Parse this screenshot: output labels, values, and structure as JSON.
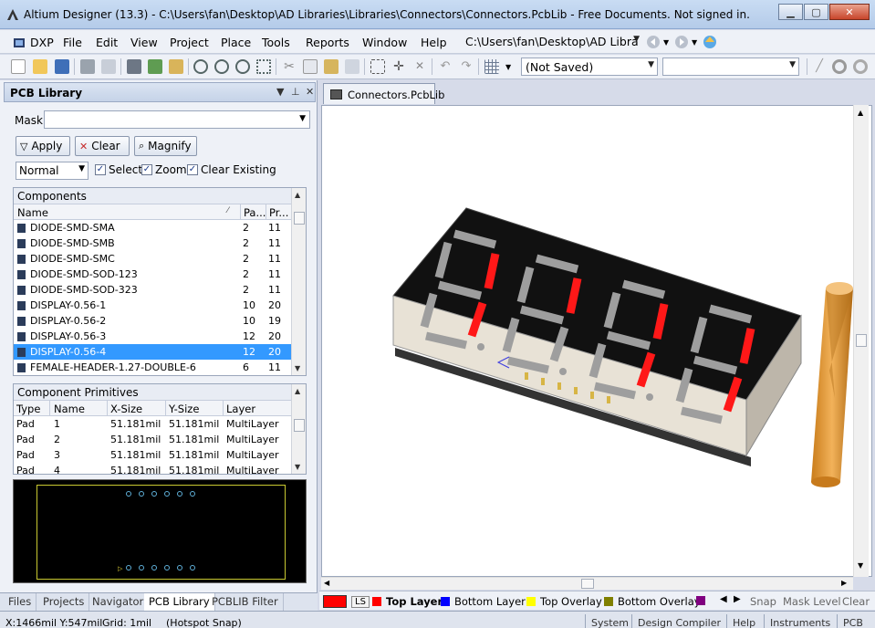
{
  "window": {
    "title": "Altium Designer (13.3) - C:\\Users\\fan\\Desktop\\AD Libraries\\Libraries\\Connectors\\Connectors.PcbLib - Free Documents. Not signed in."
  },
  "menu": {
    "items": [
      "DXP",
      "File",
      "Edit",
      "View",
      "Project",
      "Place",
      "Tools",
      "Reports",
      "Window",
      "Help"
    ],
    "path_combo": "C:\\Users\\fan\\Desktop\\AD Libra"
  },
  "toolbar": {
    "saved_state": "(Not Saved)"
  },
  "panel": {
    "title": "PCB Library",
    "mask_label": "Mask",
    "mask_value": "",
    "buttons": {
      "apply": "Apply",
      "clear": "Clear",
      "magnify": "Magnify"
    },
    "mode": "Normal",
    "checks": [
      {
        "label": "Select",
        "checked": true
      },
      {
        "label": "Zoom",
        "checked": true
      },
      {
        "label": "Clear Existing",
        "checked": true
      }
    ],
    "components": {
      "title": "Components",
      "headers": [
        "Name",
        "Pa...",
        "Pr..."
      ],
      "rows": [
        {
          "name": "DIODE-SMD-SMA",
          "pads": "2",
          "prims": "11"
        },
        {
          "name": "DIODE-SMD-SMB",
          "pads": "2",
          "prims": "11"
        },
        {
          "name": "DIODE-SMD-SMC",
          "pads": "2",
          "prims": "11"
        },
        {
          "name": "DIODE-SMD-SOD-123",
          "pads": "2",
          "prims": "11"
        },
        {
          "name": "DIODE-SMD-SOD-323",
          "pads": "2",
          "prims": "11"
        },
        {
          "name": "DISPLAY-0.56-1",
          "pads": "10",
          "prims": "20"
        },
        {
          "name": "DISPLAY-0.56-2",
          "pads": "10",
          "prims": "19"
        },
        {
          "name": "DISPLAY-0.56-3",
          "pads": "12",
          "prims": "20"
        },
        {
          "name": "DISPLAY-0.56-4",
          "pads": "12",
          "prims": "20",
          "selected": true
        },
        {
          "name": "FEMALE-HEADER-1.27-DOUBLE-6",
          "pads": "6",
          "prims": "11"
        }
      ]
    },
    "primitives": {
      "title": "Component Primitives",
      "headers": [
        "Type",
        "Name",
        "X-Size",
        "Y-Size",
        "Layer"
      ],
      "rows": [
        {
          "type": "Pad",
          "name": "1",
          "x": "51.181mil",
          "y": "51.181mil",
          "layer": "MultiLayer"
        },
        {
          "type": "Pad",
          "name": "2",
          "x": "51.181mil",
          "y": "51.181mil",
          "layer": "MultiLayer"
        },
        {
          "type": "Pad",
          "name": "3",
          "x": "51.181mil",
          "y": "51.181mil",
          "layer": "MultiLayer"
        },
        {
          "type": "Pad",
          "name": "4",
          "x": "51.181mil",
          "y": "51.181mil",
          "layer": "MultiLayer"
        }
      ]
    },
    "tabs": [
      "Files",
      "Projects",
      "Navigator",
      "PCB Library",
      "PCBLIB Filter"
    ],
    "active_tab": "PCB Library"
  },
  "document": {
    "tab": "Connectors.PcbLib"
  },
  "layers": {
    "ls": "LS",
    "items": [
      {
        "name": "Top Layer",
        "color": "#ff0000",
        "active": true
      },
      {
        "name": "Bottom Layer",
        "color": "#0000ff"
      },
      {
        "name": "Top Overlay",
        "color": "#ffff00"
      },
      {
        "name": "Bottom Overlay",
        "color": "#808000"
      }
    ],
    "extra_swatch": "#800080",
    "right": [
      "Snap",
      "Mask Level",
      "Clear"
    ]
  },
  "status": {
    "coords": "X:1466mil Y:547mil",
    "grid": "Grid: 1mil",
    "snap": "(Hotspot Snap)",
    "buttons": [
      "System",
      "Design Compiler",
      "Help",
      "Instruments",
      "PCB"
    ]
  }
}
